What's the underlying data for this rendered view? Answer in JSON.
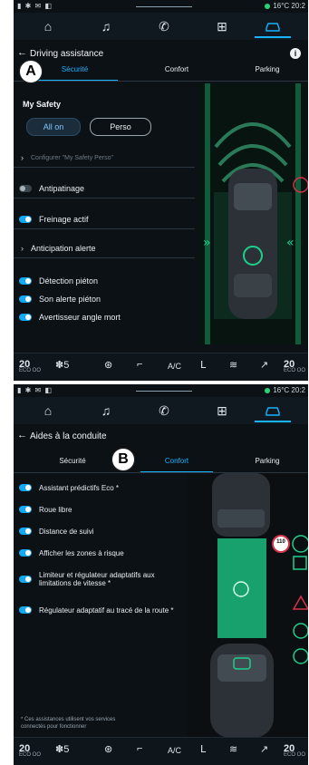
{
  "panelA": {
    "status": {
      "left": "▮ ✱ ✉ ◧",
      "right": "16°C 20:2"
    },
    "title": "Driving assistance",
    "callout": "A",
    "tabs": [
      "Sécurité",
      "Confort",
      "Parking"
    ],
    "section": "My Safety",
    "buttons": {
      "on": "All on",
      "perso": "Perso"
    },
    "configurer": "Configurer \"My Safety Perso\"",
    "items": [
      {
        "label": "Antipatinage",
        "toggle": "off"
      },
      {
        "label": "Freinage actif",
        "toggle": "on"
      },
      {
        "label": "Anticipation alerte",
        "toggle": "chevron"
      },
      {
        "label": "Détection piéton",
        "toggle": "on"
      },
      {
        "label": "Son alerte piéton",
        "toggle": "on"
      },
      {
        "label": "Avertisseur angle mort",
        "toggle": "on"
      }
    ],
    "bottom": {
      "temp_left": "20",
      "fan": "5",
      "ac": "A/C",
      "temp_right": "20"
    }
  },
  "panelB": {
    "status": {
      "left": "▮ ✱ ✉ ◧",
      "right": "16°C 20:2"
    },
    "title": "Aides à la conduite",
    "callout": "B",
    "tabs": [
      "Sécurité",
      "Confort",
      "Parking"
    ],
    "items": [
      {
        "label": "Assistant prédictifs Eco *"
      },
      {
        "label": "Roue libre"
      },
      {
        "label": "Distance de suivi"
      },
      {
        "label": "Afficher les zones à risque"
      },
      {
        "label": "Limiteur et régulateur adaptatifs aux limitations de vitesse *"
      },
      {
        "label": "Régulateur adaptatif au tracé de la route *"
      }
    ],
    "speed_badge": "110",
    "footnote": "* Ces assistances utilisent vos services connectés pour fonctionner",
    "bottom": {
      "temp_left": "20",
      "fan": "5",
      "ac": "A/C",
      "temp_right": "20"
    }
  },
  "bottom_sub": "ECO OO",
  "colors": {
    "accent": "#17b3ff",
    "green": "#1fd08c",
    "red": "#d6334a"
  }
}
